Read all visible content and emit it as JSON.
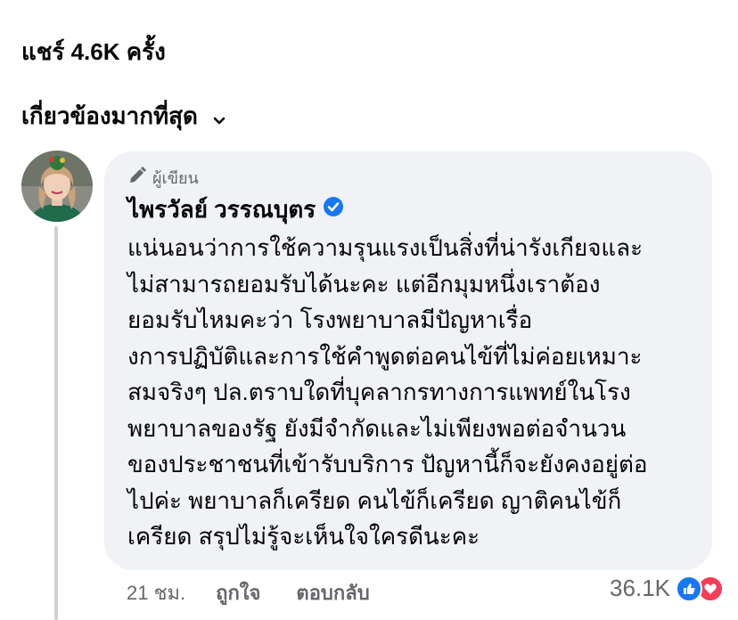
{
  "shares": {
    "text": "แชร์ 4.6K ครั้ง"
  },
  "sort": {
    "label": "เกี่ยวข้องมากที่สุด"
  },
  "comment": {
    "badge": "ผู้เขียน",
    "author": "ไพรวัลย์ วรรณบุตร",
    "text": "แน่นอนว่าการใช้ความรุนแรงเป็นสิ่งที่น่ารังเกียจและ\nไม่สามารถยอมรับได้นะคะ  แต่อีกมุมหนึ่งเราต้อง\nยอมรับไหมคะว่า โรงพยาบาลมีปัญหาเรื่อ\nงการปฏิบัติและการใช้คำพูดต่อคนไข้ที่ไม่ค่อยเหมาะ\nสมจริงๆ ปล.ตราบใดที่บุคลากรทางการแพทย์ในโรง\nพยาบาลของรัฐ ยังมีจำกัดและไม่เพียงพอต่อจำนวน\nของประชาชนที่เข้ารับบริการ ปัญหานี้ก็จะยังคงอยู่ต่อ\nไปค่ะ พยาบาลก็เครียด คนไข้ก็เครียด ญาติคนไข้ก็\nเครียด  สรุปไม่รู้จะเห็นใจใครดีนะคะ",
    "time": "21 ชม.",
    "like": "ถูกใจ",
    "reply": "ตอบกลับ",
    "reactions_count": "36.1K",
    "icons": [
      "pen-icon",
      "verified-badge-icon",
      "like-reaction-icon",
      "love-reaction-icon",
      "chevron-down-icon"
    ]
  },
  "colors": {
    "background": "#ffffff",
    "bubble": "#f0f2f5",
    "text": "#050505",
    "secondary_text": "#65676b",
    "verified": "#1877f2",
    "like": "#1877f2",
    "love": "#f33e58"
  }
}
